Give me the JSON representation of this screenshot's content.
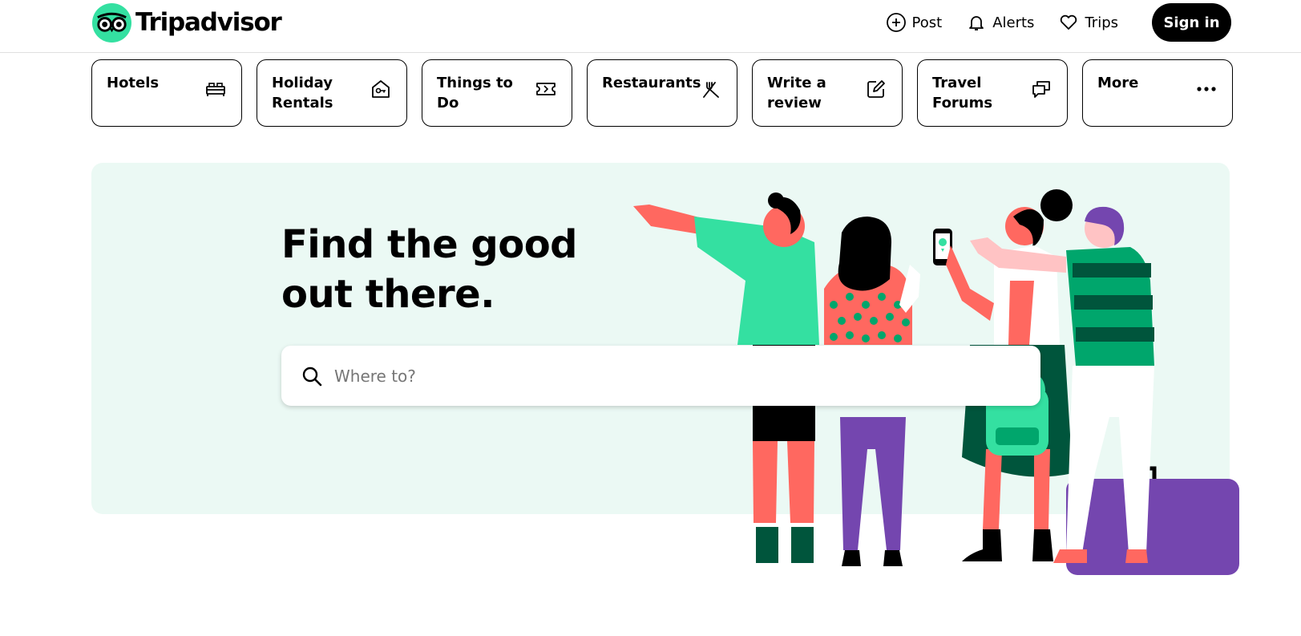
{
  "brand": {
    "name": "Tripadvisor",
    "color": "#34e0a1"
  },
  "header": {
    "links": [
      {
        "label": "Post",
        "icon": "plus-circle-icon"
      },
      {
        "label": "Alerts",
        "icon": "bell-icon"
      },
      {
        "label": "Trips",
        "icon": "heart-icon"
      }
    ],
    "signin_label": "Sign in"
  },
  "categories": [
    {
      "label": "Hotels",
      "icon": "bed-icon"
    },
    {
      "label": "Holiday Rentals",
      "icon": "house-key-icon"
    },
    {
      "label": "Things to Do",
      "icon": "ticket-icon"
    },
    {
      "label": "Restaurants",
      "icon": "fork-knife-icon"
    },
    {
      "label": "Write a review",
      "icon": "pencil-icon"
    },
    {
      "label": "Travel Forums",
      "icon": "chat-bubbles-icon"
    },
    {
      "label": "More",
      "icon": "more-dots-icon"
    }
  ],
  "hero": {
    "title": "Find the good out there.",
    "background": "#ebf9f4",
    "search": {
      "placeholder": "Where to?"
    }
  }
}
